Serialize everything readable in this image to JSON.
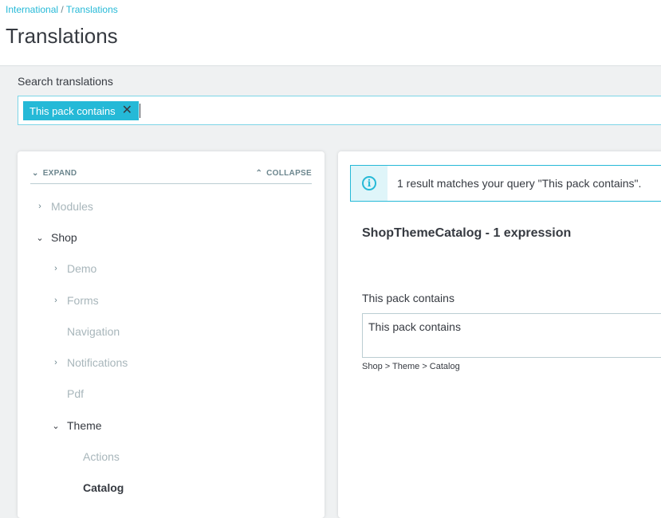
{
  "breadcrumb": {
    "parent": "International",
    "separator": "/",
    "current": "Translations"
  },
  "page": {
    "title": "Translations"
  },
  "search": {
    "label": "Search translations",
    "tag": "This pack contains",
    "tag_close": "✕"
  },
  "tree": {
    "expand_label": "EXPAND",
    "collapse_label": "COLLAPSE",
    "items": [
      {
        "label": "Modules",
        "chevron": "›"
      },
      {
        "label": "Shop",
        "chevron": "⌄"
      },
      {
        "label": "Demo",
        "chevron": "›"
      },
      {
        "label": "Forms",
        "chevron": "›"
      },
      {
        "label": "Navigation",
        "chevron": ""
      },
      {
        "label": "Notifications",
        "chevron": "›"
      },
      {
        "label": "Pdf",
        "chevron": ""
      },
      {
        "label": "Theme",
        "chevron": "⌄"
      },
      {
        "label": "Actions",
        "chevron": ""
      },
      {
        "label": "Catalog",
        "chevron": ""
      }
    ]
  },
  "content": {
    "alert_text": "1 result matches your query \"This pack contains\".",
    "domain_title": "ShopThemeCatalog - 1 expression",
    "expression_label": "This pack contains",
    "expression_value": "This pack contains",
    "expression_path": "Shop > Theme > Catalog"
  },
  "colors": {
    "accent": "#25b9d7",
    "text": "#363a41",
    "muted": "#a8b6bb",
    "background": "#eff1f2"
  }
}
